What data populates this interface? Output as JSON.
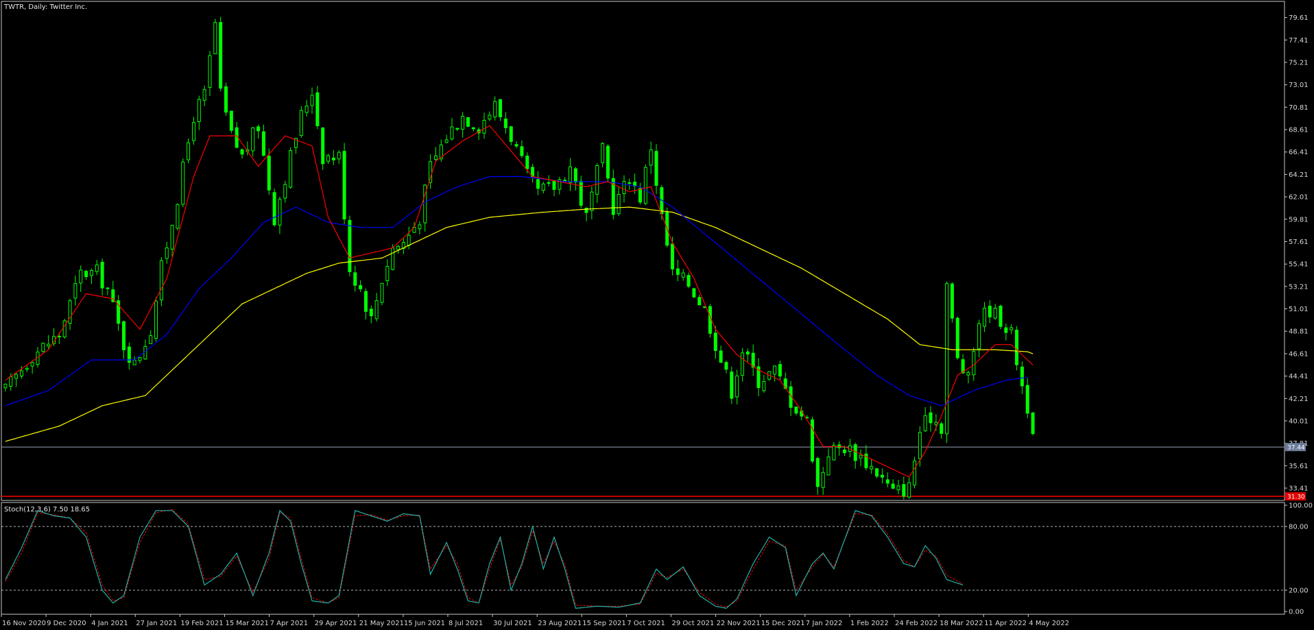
{
  "chart_title": "TWTR, Daily:  Twitter Inc.",
  "indicator_label": "Stoch(12,3,6) 7.50 18.65",
  "colors": {
    "background": "#000000",
    "frame": "#c8c8c8",
    "candle": "#00ff00",
    "ma_fast": "#ff0000",
    "ma_mid": "#0000ff",
    "ma_slow": "#ffff00",
    "stoch_main": "#20b2aa",
    "stoch_signal": "#ff0000",
    "levels": "#b4b4b4",
    "current_price_line": "#9aa3b8",
    "low_level_line": "#ff0000"
  },
  "chart_data": {
    "type": "candlestick",
    "symbol": "TWTR",
    "timeframe": "Daily",
    "price_axis": {
      "range": [
        32.2,
        81.2
      ],
      "ticks": [
        "79.61",
        "77.41",
        "75.21",
        "73.01",
        "70.81",
        "68.61",
        "66.41",
        "64.21",
        "62.01",
        "59.81",
        "57.61",
        "55.41",
        "53.21",
        "51.01",
        "48.81",
        "46.61",
        "44.41",
        "42.21",
        "40.01",
        "37.81",
        "35.61",
        "33.41"
      ],
      "current_price_tag": "37.44",
      "current_price": 37.44,
      "low_level_tag": "31.30",
      "low_level": 32.6
    },
    "date_axis": [
      "16 Nov 2020",
      "9 Dec 2020",
      "4 Jan 2021",
      "27 Jan 2021",
      "19 Feb 2021",
      "15 Mar 2021",
      "7 Apr 2021",
      "29 Apr 2021",
      "21 May 2021",
      "15 Jun 2021",
      "8 Jul 2021",
      "30 Jul 2021",
      "23 Aug 2021",
      "15 Sep 2021",
      "7 Oct 2021",
      "29 Oct 2021",
      "22 Nov 2021",
      "15 Dec 2021",
      "7 Jan 2022",
      "1 Feb 2022",
      "24 Feb 2022",
      "18 Mar 2022",
      "11 Apr 2022",
      "4 May 2022"
    ],
    "close_path": [
      [
        0,
        43.0
      ],
      [
        5,
        46.5
      ],
      [
        10,
        48.5
      ],
      [
        14,
        54.5
      ],
      [
        17,
        54.6
      ],
      [
        19,
        53.0
      ],
      [
        22,
        47.5
      ],
      [
        24,
        45.5
      ],
      [
        27,
        49.0
      ],
      [
        29,
        55.0
      ],
      [
        32,
        62.0
      ],
      [
        35,
        70.0
      ],
      [
        37,
        72.0
      ],
      [
        39,
        79.0
      ],
      [
        40,
        72.0
      ],
      [
        42,
        68.0
      ],
      [
        44,
        66.0
      ],
      [
        47,
        69.0
      ],
      [
        50,
        60.0
      ],
      [
        52,
        64.0
      ],
      [
        55,
        70.0
      ],
      [
        57,
        72.5
      ],
      [
        59,
        66.0
      ],
      [
        62,
        66.0
      ],
      [
        64,
        55.0
      ],
      [
        66,
        53.0
      ],
      [
        68,
        50.0
      ],
      [
        70,
        54.0
      ],
      [
        72,
        57.0
      ],
      [
        74,
        57.5
      ],
      [
        77,
        60.0
      ],
      [
        79,
        65.0
      ],
      [
        82,
        68.0
      ],
      [
        85,
        70.0
      ],
      [
        88,
        69.0
      ],
      [
        91,
        71.0
      ],
      [
        94,
        68.0
      ],
      [
        97,
        64.0
      ],
      [
        99,
        62.5
      ],
      [
        102,
        63.0
      ],
      [
        105,
        65.0
      ],
      [
        108,
        60.0
      ],
      [
        111,
        66.5
      ],
      [
        113,
        61.0
      ],
      [
        116,
        64.0
      ],
      [
        118,
        62.0
      ],
      [
        120,
        67.0
      ],
      [
        122,
        60.0
      ],
      [
        124,
        54.5
      ],
      [
        127,
        53.5
      ],
      [
        130,
        51.0
      ],
      [
        133,
        46.0
      ],
      [
        135,
        43.0
      ],
      [
        137,
        47.0
      ],
      [
        140,
        44.0
      ],
      [
        143,
        45.0
      ],
      [
        146,
        42.0
      ],
      [
        149,
        40.0
      ],
      [
        151,
        33.5
      ],
      [
        153,
        37.0
      ],
      [
        156,
        37.5
      ],
      [
        159,
        36.5
      ],
      [
        162,
        35.0
      ],
      [
        165,
        33.0
      ],
      [
        168,
        33.5
      ],
      [
        170,
        39.0
      ],
      [
        172,
        40.5
      ],
      [
        174,
        39.5
      ],
      [
        175,
        53.5
      ],
      [
        177,
        46.0
      ],
      [
        179,
        44.0
      ],
      [
        181,
        50.0
      ],
      [
        183,
        51.0
      ],
      [
        185,
        50.0
      ],
      [
        187,
        48.5
      ],
      [
        189,
        43.5
      ],
      [
        190,
        41.5
      ],
      [
        191,
        38.0
      ]
    ],
    "ma_fast": [
      [
        0,
        44.0
      ],
      [
        8,
        47.0
      ],
      [
        15,
        52.5
      ],
      [
        20,
        52.0
      ],
      [
        25,
        49.0
      ],
      [
        30,
        54.0
      ],
      [
        35,
        64.0
      ],
      [
        38,
        68.0
      ],
      [
        43,
        68.0
      ],
      [
        47,
        65.0
      ],
      [
        52,
        68.0
      ],
      [
        57,
        67.0
      ],
      [
        60,
        60.0
      ],
      [
        64,
        56.0
      ],
      [
        68,
        56.5
      ],
      [
        72,
        57.0
      ],
      [
        76,
        59.0
      ],
      [
        80,
        65.5
      ],
      [
        85,
        67.5
      ],
      [
        90,
        69.0
      ],
      [
        94,
        66.5
      ],
      [
        98,
        64.0
      ],
      [
        103,
        63.5
      ],
      [
        108,
        63.0
      ],
      [
        112,
        63.5
      ],
      [
        116,
        62.5
      ],
      [
        120,
        63.0
      ],
      [
        124,
        57.5
      ],
      [
        128,
        54.0
      ],
      [
        132,
        49.0
      ],
      [
        136,
        46.5
      ],
      [
        140,
        45.0
      ],
      [
        144,
        44.0
      ],
      [
        148,
        41.0
      ],
      [
        152,
        37.5
      ],
      [
        156,
        37.5
      ],
      [
        160,
        36.5
      ],
      [
        164,
        35.5
      ],
      [
        168,
        34.5
      ],
      [
        171,
        37.0
      ],
      [
        174,
        40.5
      ],
      [
        177,
        44.5
      ],
      [
        180,
        45.5
      ],
      [
        184,
        47.5
      ],
      [
        187,
        47.5
      ],
      [
        190,
        46.0
      ],
      [
        191,
        45.5
      ]
    ],
    "ma_mid": [
      [
        0,
        41.5
      ],
      [
        8,
        43.0
      ],
      [
        16,
        46.0
      ],
      [
        24,
        46.0
      ],
      [
        30,
        48.5
      ],
      [
        36,
        53.0
      ],
      [
        42,
        56.0
      ],
      [
        48,
        59.5
      ],
      [
        54,
        61.0
      ],
      [
        60,
        59.5
      ],
      [
        66,
        59.0
      ],
      [
        72,
        59.0
      ],
      [
        78,
        61.5
      ],
      [
        84,
        63.0
      ],
      [
        90,
        64.0
      ],
      [
        96,
        64.0
      ],
      [
        104,
        63.5
      ],
      [
        112,
        63.5
      ],
      [
        118,
        63.0
      ],
      [
        124,
        61.0
      ],
      [
        132,
        57.5
      ],
      [
        140,
        54.0
      ],
      [
        148,
        50.5
      ],
      [
        156,
        47.0
      ],
      [
        162,
        44.5
      ],
      [
        168,
        42.5
      ],
      [
        174,
        41.5
      ],
      [
        180,
        43.0
      ],
      [
        186,
        44.0
      ],
      [
        190,
        44.3
      ]
    ],
    "ma_slow": [
      [
        0,
        38.0
      ],
      [
        10,
        39.5
      ],
      [
        18,
        41.5
      ],
      [
        26,
        42.5
      ],
      [
        32,
        45.5
      ],
      [
        38,
        48.5
      ],
      [
        44,
        51.5
      ],
      [
        50,
        53.0
      ],
      [
        56,
        54.5
      ],
      [
        62,
        55.5
      ],
      [
        70,
        56.0
      ],
      [
        76,
        57.5
      ],
      [
        82,
        59.0
      ],
      [
        90,
        60.0
      ],
      [
        100,
        60.5
      ],
      [
        108,
        60.8
      ],
      [
        116,
        61.0
      ],
      [
        124,
        60.5
      ],
      [
        132,
        59.0
      ],
      [
        140,
        57.0
      ],
      [
        148,
        55.0
      ],
      [
        156,
        52.5
      ],
      [
        164,
        50.0
      ],
      [
        170,
        47.5
      ],
      [
        176,
        47.0
      ],
      [
        184,
        47.0
      ],
      [
        190,
        46.8
      ],
      [
        191,
        46.6
      ]
    ],
    "stochastic": {
      "params": "Stoch(12,3,6)",
      "main_value": 7.5,
      "signal_value": 18.65,
      "levels": [
        80,
        20
      ],
      "axis_ticks": [
        "100.00",
        "80.00",
        "20.00",
        "0.00"
      ],
      "main_path": [
        [
          0,
          30
        ],
        [
          3,
          60
        ],
        [
          6,
          95
        ],
        [
          9,
          90
        ],
        [
          12,
          88
        ],
        [
          15,
          70
        ],
        [
          18,
          20
        ],
        [
          20,
          8
        ],
        [
          22,
          15
        ],
        [
          25,
          70
        ],
        [
          28,
          95
        ],
        [
          31,
          95
        ],
        [
          34,
          80
        ],
        [
          37,
          25
        ],
        [
          40,
          35
        ],
        [
          43,
          55
        ],
        [
          46,
          15
        ],
        [
          49,
          55
        ],
        [
          51,
          95
        ],
        [
          53,
          85
        ],
        [
          55,
          45
        ],
        [
          57,
          10
        ],
        [
          60,
          8
        ],
        [
          62,
          15
        ],
        [
          65,
          95
        ],
        [
          68,
          90
        ],
        [
          71,
          85
        ],
        [
          74,
          92
        ],
        [
          77,
          90
        ],
        [
          79,
          35
        ],
        [
          82,
          65
        ],
        [
          84,
          40
        ],
        [
          86,
          10
        ],
        [
          88,
          8
        ],
        [
          90,
          45
        ],
        [
          92,
          70
        ],
        [
          94,
          20
        ],
        [
          96,
          45
        ],
        [
          98,
          80
        ],
        [
          100,
          40
        ],
        [
          102,
          70
        ],
        [
          104,
          40
        ],
        [
          106,
          3
        ],
        [
          110,
          5
        ],
        [
          114,
          4
        ],
        [
          118,
          8
        ],
        [
          121,
          40
        ],
        [
          123,
          30
        ],
        [
          126,
          42
        ],
        [
          129,
          15
        ],
        [
          132,
          5
        ],
        [
          134,
          3
        ],
        [
          136,
          12
        ],
        [
          139,
          45
        ],
        [
          142,
          70
        ],
        [
          145,
          60
        ],
        [
          147,
          15
        ],
        [
          150,
          45
        ],
        [
          152,
          55
        ],
        [
          154,
          40
        ],
        [
          158,
          95
        ],
        [
          161,
          90
        ],
        [
          164,
          70
        ],
        [
          167,
          45
        ],
        [
          169,
          42
        ],
        [
          171,
          62
        ],
        [
          173,
          50
        ],
        [
          175,
          30
        ],
        [
          178,
          25
        ]
      ],
      "signal_path": [
        [
          0,
          28
        ],
        [
          3,
          55
        ],
        [
          6,
          93
        ],
        [
          9,
          91
        ],
        [
          12,
          88
        ],
        [
          15,
          74
        ],
        [
          18,
          25
        ],
        [
          20,
          10
        ],
        [
          22,
          13
        ],
        [
          25,
          65
        ],
        [
          28,
          93
        ],
        [
          31,
          96
        ],
        [
          34,
          82
        ],
        [
          37,
          30
        ],
        [
          40,
          33
        ],
        [
          43,
          52
        ],
        [
          46,
          18
        ],
        [
          49,
          50
        ],
        [
          51,
          93
        ],
        [
          53,
          88
        ],
        [
          55,
          50
        ],
        [
          57,
          13
        ],
        [
          60,
          8
        ],
        [
          62,
          13
        ],
        [
          65,
          90
        ],
        [
          68,
          91
        ],
        [
          71,
          86
        ],
        [
          74,
          90
        ],
        [
          77,
          91
        ],
        [
          79,
          40
        ],
        [
          82,
          62
        ],
        [
          84,
          45
        ],
        [
          86,
          13
        ],
        [
          88,
          8
        ],
        [
          90,
          40
        ],
        [
          92,
          68
        ],
        [
          94,
          25
        ],
        [
          96,
          42
        ],
        [
          98,
          76
        ],
        [
          100,
          45
        ],
        [
          102,
          66
        ],
        [
          104,
          44
        ],
        [
          106,
          6
        ],
        [
          110,
          5
        ],
        [
          114,
          5
        ],
        [
          118,
          7
        ],
        [
          121,
          36
        ],
        [
          123,
          32
        ],
        [
          126,
          40
        ],
        [
          129,
          18
        ],
        [
          132,
          7
        ],
        [
          134,
          4
        ],
        [
          136,
          10
        ],
        [
          139,
          40
        ],
        [
          142,
          66
        ],
        [
          145,
          62
        ],
        [
          147,
          20
        ],
        [
          150,
          42
        ],
        [
          152,
          54
        ],
        [
          154,
          42
        ],
        [
          158,
          92
        ],
        [
          161,
          91
        ],
        [
          164,
          73
        ],
        [
          167,
          48
        ],
        [
          169,
          42
        ],
        [
          171,
          58
        ],
        [
          173,
          52
        ],
        [
          175,
          34
        ],
        [
          178,
          26
        ]
      ]
    }
  }
}
